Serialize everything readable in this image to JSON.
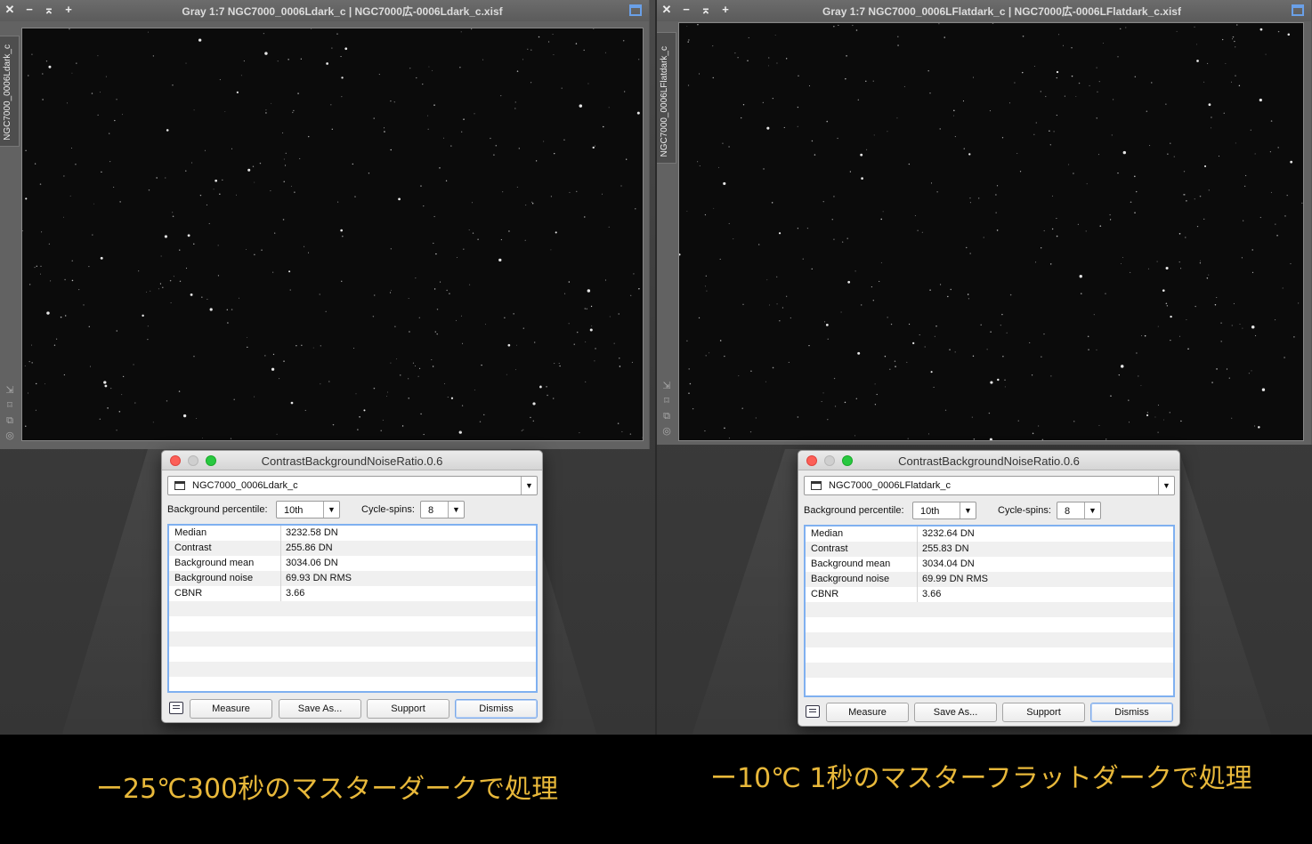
{
  "left": {
    "window": {
      "title": "Gray 1:7 NGC7000_0006Ldark_c | NGC7000広-0006Ldark_c.xisf",
      "side_tab": "NGC7000_0006Ldark_c",
      "title_buttons": [
        "✕",
        "−",
        "⌅",
        "+"
      ]
    },
    "dialog": {
      "title": "ContrastBackgroundNoiseRatio.0.6",
      "view": "NGC7000_0006Ldark_c",
      "bg_percentile_label": "Background percentile:",
      "bg_percentile_value": "10th",
      "cycle_spins_label": "Cycle-spins:",
      "cycle_spins_value": "8",
      "results": [
        {
          "key": "Median",
          "value": "3232.58 DN"
        },
        {
          "key": "Contrast",
          "value": "255.86 DN"
        },
        {
          "key": "Background mean",
          "value": "3034.06 DN"
        },
        {
          "key": "Background noise",
          "value": "69.93 DN RMS"
        },
        {
          "key": "CBNR",
          "value": "3.66"
        }
      ],
      "buttons": {
        "measure": "Measure",
        "save_as": "Save As...",
        "support": "Support",
        "dismiss": "Dismiss"
      }
    },
    "caption": "ー25℃300秒のマスターダークで処理"
  },
  "right": {
    "window": {
      "title": "Gray 1:7 NGC7000_0006LFlatdark_c | NGC7000広-0006LFlatdark_c.xisf",
      "side_tab": "NGC7000_0006LFlatdark_c",
      "title_buttons": [
        "✕",
        "−",
        "⌅",
        "+"
      ]
    },
    "dialog": {
      "title": "ContrastBackgroundNoiseRatio.0.6",
      "view": "NGC7000_0006LFlatdark_c",
      "bg_percentile_label": "Background percentile:",
      "bg_percentile_value": "10th",
      "cycle_spins_label": "Cycle-spins:",
      "cycle_spins_value": "8",
      "results": [
        {
          "key": "Median",
          "value": "3232.64 DN"
        },
        {
          "key": "Contrast",
          "value": "255.83 DN"
        },
        {
          "key": "Background mean",
          "value": "3034.04 DN"
        },
        {
          "key": "Background noise",
          "value": "69.99 DN RMS"
        },
        {
          "key": "CBNR",
          "value": "3.66"
        }
      ],
      "buttons": {
        "measure": "Measure",
        "save_as": "Save As...",
        "support": "Support",
        "dismiss": "Dismiss"
      }
    },
    "caption": "ー10℃ 1秒のマスターフラットダークで処理"
  },
  "colors": {
    "caption": "#e8b83a",
    "selection": "#7fb0f0",
    "starfield": "#0b0b0b"
  },
  "icons": [
    "close-icon",
    "minimize-icon",
    "shade-icon",
    "add-icon",
    "maximize-icon",
    "view-icon",
    "dropdown-arrow-icon",
    "notes-icon",
    "zoom-icon",
    "fit-icon",
    "clone-icon",
    "target-icon"
  ]
}
